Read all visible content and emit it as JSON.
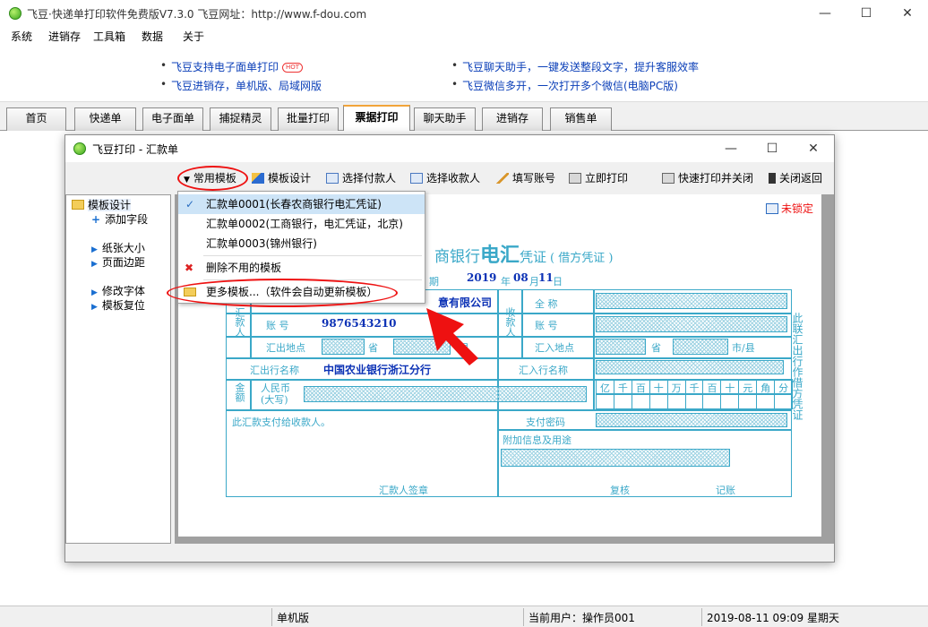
{
  "window": {
    "title": "飞豆·快递单打印软件免费版V7.3.0   飞豆网址：http://www.f-dou.com",
    "controls": {
      "minimize": "—",
      "maximize": "☐",
      "close": "✕"
    }
  },
  "menu": [
    "系统",
    "进销存",
    "工具箱",
    "数据",
    "关于"
  ],
  "ads": {
    "left": [
      "飞豆支持电子面单打印",
      "飞豆进销存，单机版、局域网版"
    ],
    "hot_badge": "HOT",
    "right": [
      "飞豆聊天助手，一键发送整段文字，提升客服效率",
      "飞豆微信多开，一次打开多个微信(电脑PC版)"
    ]
  },
  "tabs": [
    "首页",
    "快递单",
    "电子面单",
    "捕捉精灵",
    "批量打印",
    "票据打印",
    "聊天助手",
    "进销存",
    "销售单"
  ],
  "active_tab": "票据打印",
  "dialog": {
    "title": "飞豆打印 - 汇款单",
    "controls": {
      "minimize": "—",
      "maximize": "☐",
      "close": "✕"
    },
    "toolbar": {
      "templates": "常用模板",
      "design": "模板设计",
      "payer": "选择付款人",
      "payee": "选择收款人",
      "account": "填写账号",
      "print": "立即打印",
      "quick_print": "快速打印并关闭",
      "close": "关闭返回"
    },
    "tree": {
      "root": "模板设计",
      "add_field": "添加字段",
      "paper_size": "纸张大小",
      "page_margin": "页面边距",
      "font": "修改字体",
      "reset": "模板复位"
    },
    "lock_label": "未锁定"
  },
  "dropdown": {
    "items": [
      "汇款单0001(长春农商银行电汇凭证)",
      "汇款单0002(工商银行，电汇凭证，北京)",
      "汇款单0003(锦州银行)"
    ],
    "delete": "删除不用的模板",
    "more": "更多模板...（软件会自动更新模板）"
  },
  "voucher": {
    "heading_prefix": "商银行",
    "heading_big": "电汇",
    "heading_mid": "凭证",
    "heading_paren": "( 借方凭证 )",
    "date_label": "期",
    "year": "2019",
    "year_unit": "年",
    "month": "08",
    "month_unit": "月",
    "day": "11",
    "day_unit": "日",
    "payer_name_value": "意有限公司",
    "payer_account_label": "账    号",
    "payer_account_value": "9876543210",
    "payer_group": "汇款人",
    "payer_location_label": "汇出地点",
    "province": "省",
    "city_suffix": "县",
    "payer_bank_label": "汇出行名称",
    "payer_bank_value": "中国农业银行浙江分行",
    "payee_group": "收款人",
    "payee_name_label": "全    称",
    "payee_account_label": "账    号",
    "payee_location_label": "汇入地点",
    "payee_province": "省",
    "payee_city": "市/县",
    "payee_bank_label": "汇入行名称",
    "amount_group": "金额",
    "rmb_label": "人民币\n(大写)",
    "digits": [
      "亿",
      "千",
      "百",
      "十",
      "万",
      "千",
      "百",
      "十",
      "元",
      "角",
      "分"
    ],
    "pay_to_note": "此汇款支付给收款人。",
    "pay_password": "支付密码",
    "extra_info": "附加信息及用途",
    "payer_sign": "汇款人签章",
    "review": "复核",
    "bookkeeper": "记账",
    "side_note": "此联汇出行作借方凭证"
  },
  "status": {
    "mode": "单机版",
    "user": "当前用户：操作员001",
    "datetime": "2019-08-11  09:09  星期天"
  },
  "colors": {
    "form_line": "#3aa8c8",
    "form_value": "#0b31b5",
    "annotation": "#e11111",
    "active_tab_accent": "#f2a43a"
  }
}
